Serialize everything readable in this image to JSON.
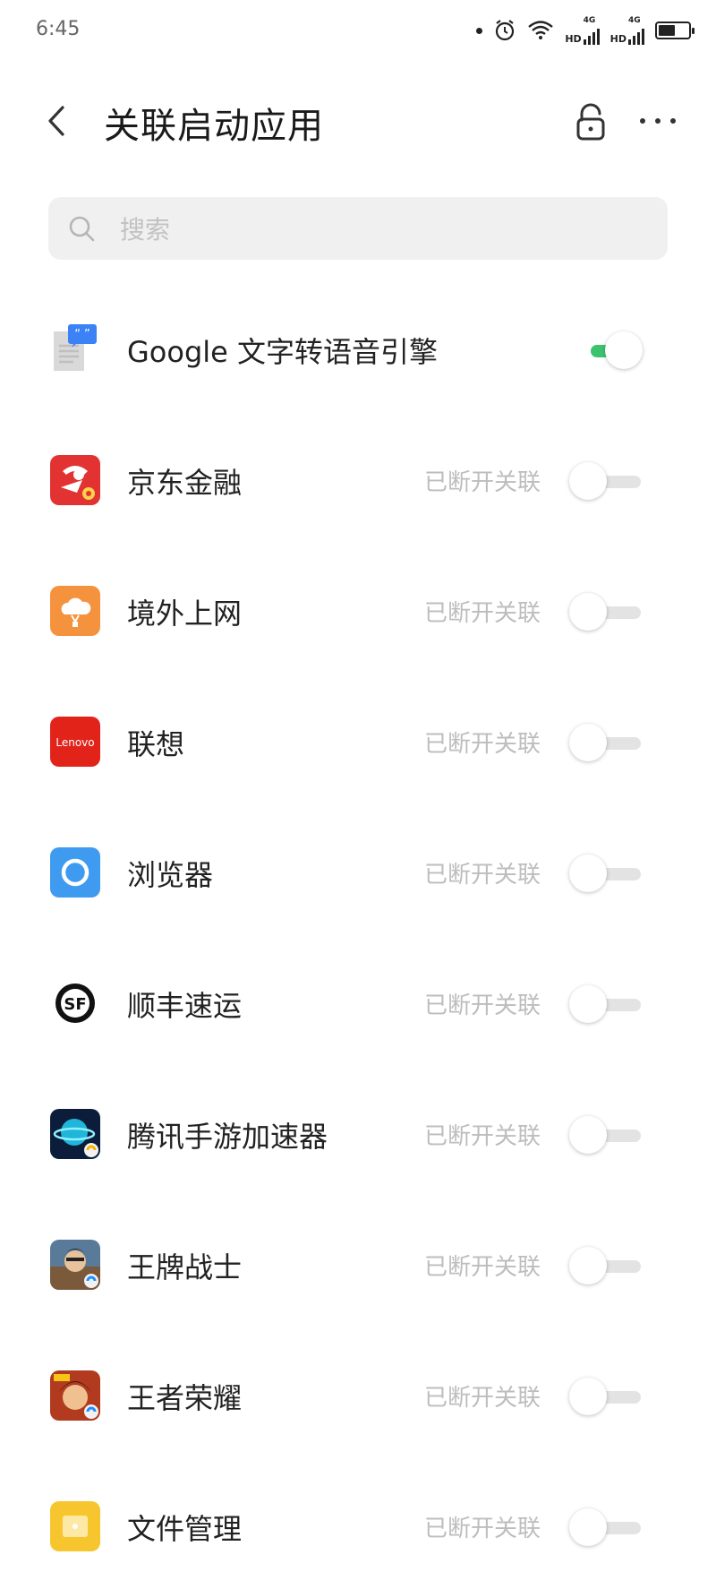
{
  "status_bar": {
    "time": "6:45",
    "hd1": "HD",
    "hd2": "HD",
    "net1": "4G",
    "net2": "4G"
  },
  "header": {
    "title": "关联启动应用"
  },
  "search": {
    "placeholder": "搜索"
  },
  "apps": [
    {
      "name": "Google 文字转语音引擎",
      "status": "",
      "enabled": true,
      "icon": "google-tts-icon"
    },
    {
      "name": "京东金融",
      "status": "已断开关联",
      "enabled": false,
      "icon": "jd-finance-icon"
    },
    {
      "name": "境外上网",
      "status": "已断开关联",
      "enabled": false,
      "icon": "overseas-internet-icon"
    },
    {
      "name": "联想",
      "status": "已断开关联",
      "enabled": false,
      "icon": "lenovo-icon",
      "icon_text": "Lenovo"
    },
    {
      "name": "浏览器",
      "status": "已断开关联",
      "enabled": false,
      "icon": "browser-icon"
    },
    {
      "name": "顺丰速运",
      "status": "已断开关联",
      "enabled": false,
      "icon": "sf-express-icon",
      "icon_text": "SF"
    },
    {
      "name": "腾讯手游加速器",
      "status": "已断开关联",
      "enabled": false,
      "icon": "tencent-game-accelerator-icon"
    },
    {
      "name": "王牌战士",
      "status": "已断开关联",
      "enabled": false,
      "icon": "ace-warrior-icon"
    },
    {
      "name": "王者荣耀",
      "status": "已断开关联",
      "enabled": false,
      "icon": "honor-of-kings-icon"
    },
    {
      "name": "文件管理",
      "status": "已断开关联",
      "enabled": false,
      "icon": "file-manager-icon"
    }
  ],
  "colors": {
    "toggle_on": "#3cc36d",
    "toggle_off": "#e3e3e3",
    "status_text": "#bdbdbd"
  }
}
